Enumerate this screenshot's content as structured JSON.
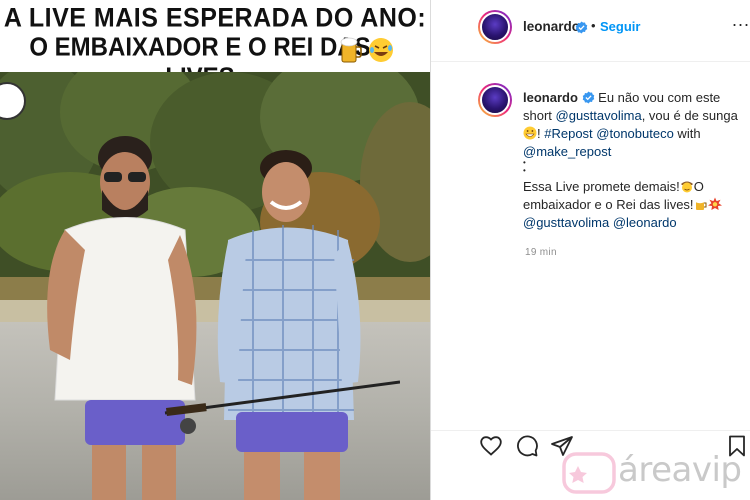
{
  "headline": {
    "line1": "A LIVE MAIS ESPERADA DO ANO:",
    "line2": "O EMBAIXADOR E O REI DAS LIVES"
  },
  "header": {
    "username": "leonardo",
    "separator": "•",
    "follow_label": "Seguir",
    "more_label": "..."
  },
  "caption": {
    "username": "leonardo",
    "line1_text": "Eu não vou com este",
    "line2_prefix": "short ",
    "line2_mention": "@gusttavolima",
    "line2_suffix": ", vou é de sunga",
    "line3_hashtag": "#Repost",
    "line3_mention": "@tonobuteco",
    "line3_suffix": " with",
    "line4_mention": "@make_repost",
    "dots1": "•",
    "dots2": "•",
    "dots3": "•",
    "para2_line1": "Essa Live promete demais!",
    "para2_line1_end": "O",
    "para2_line2": "embaixador e o Rei das lives!",
    "para2_mention1": "@gusttavolima",
    "para2_mention2": "@leonardo"
  },
  "time_label": "19 min",
  "watermark": "áreavip",
  "icons": [
    "heart-icon",
    "comment-icon",
    "share-icon",
    "bookmark-icon",
    "verified-icon",
    "more-icon"
  ],
  "colors": {
    "link": "#00376b",
    "follow": "#0095f6",
    "text": "#262626",
    "muted": "#8e8e8e"
  }
}
